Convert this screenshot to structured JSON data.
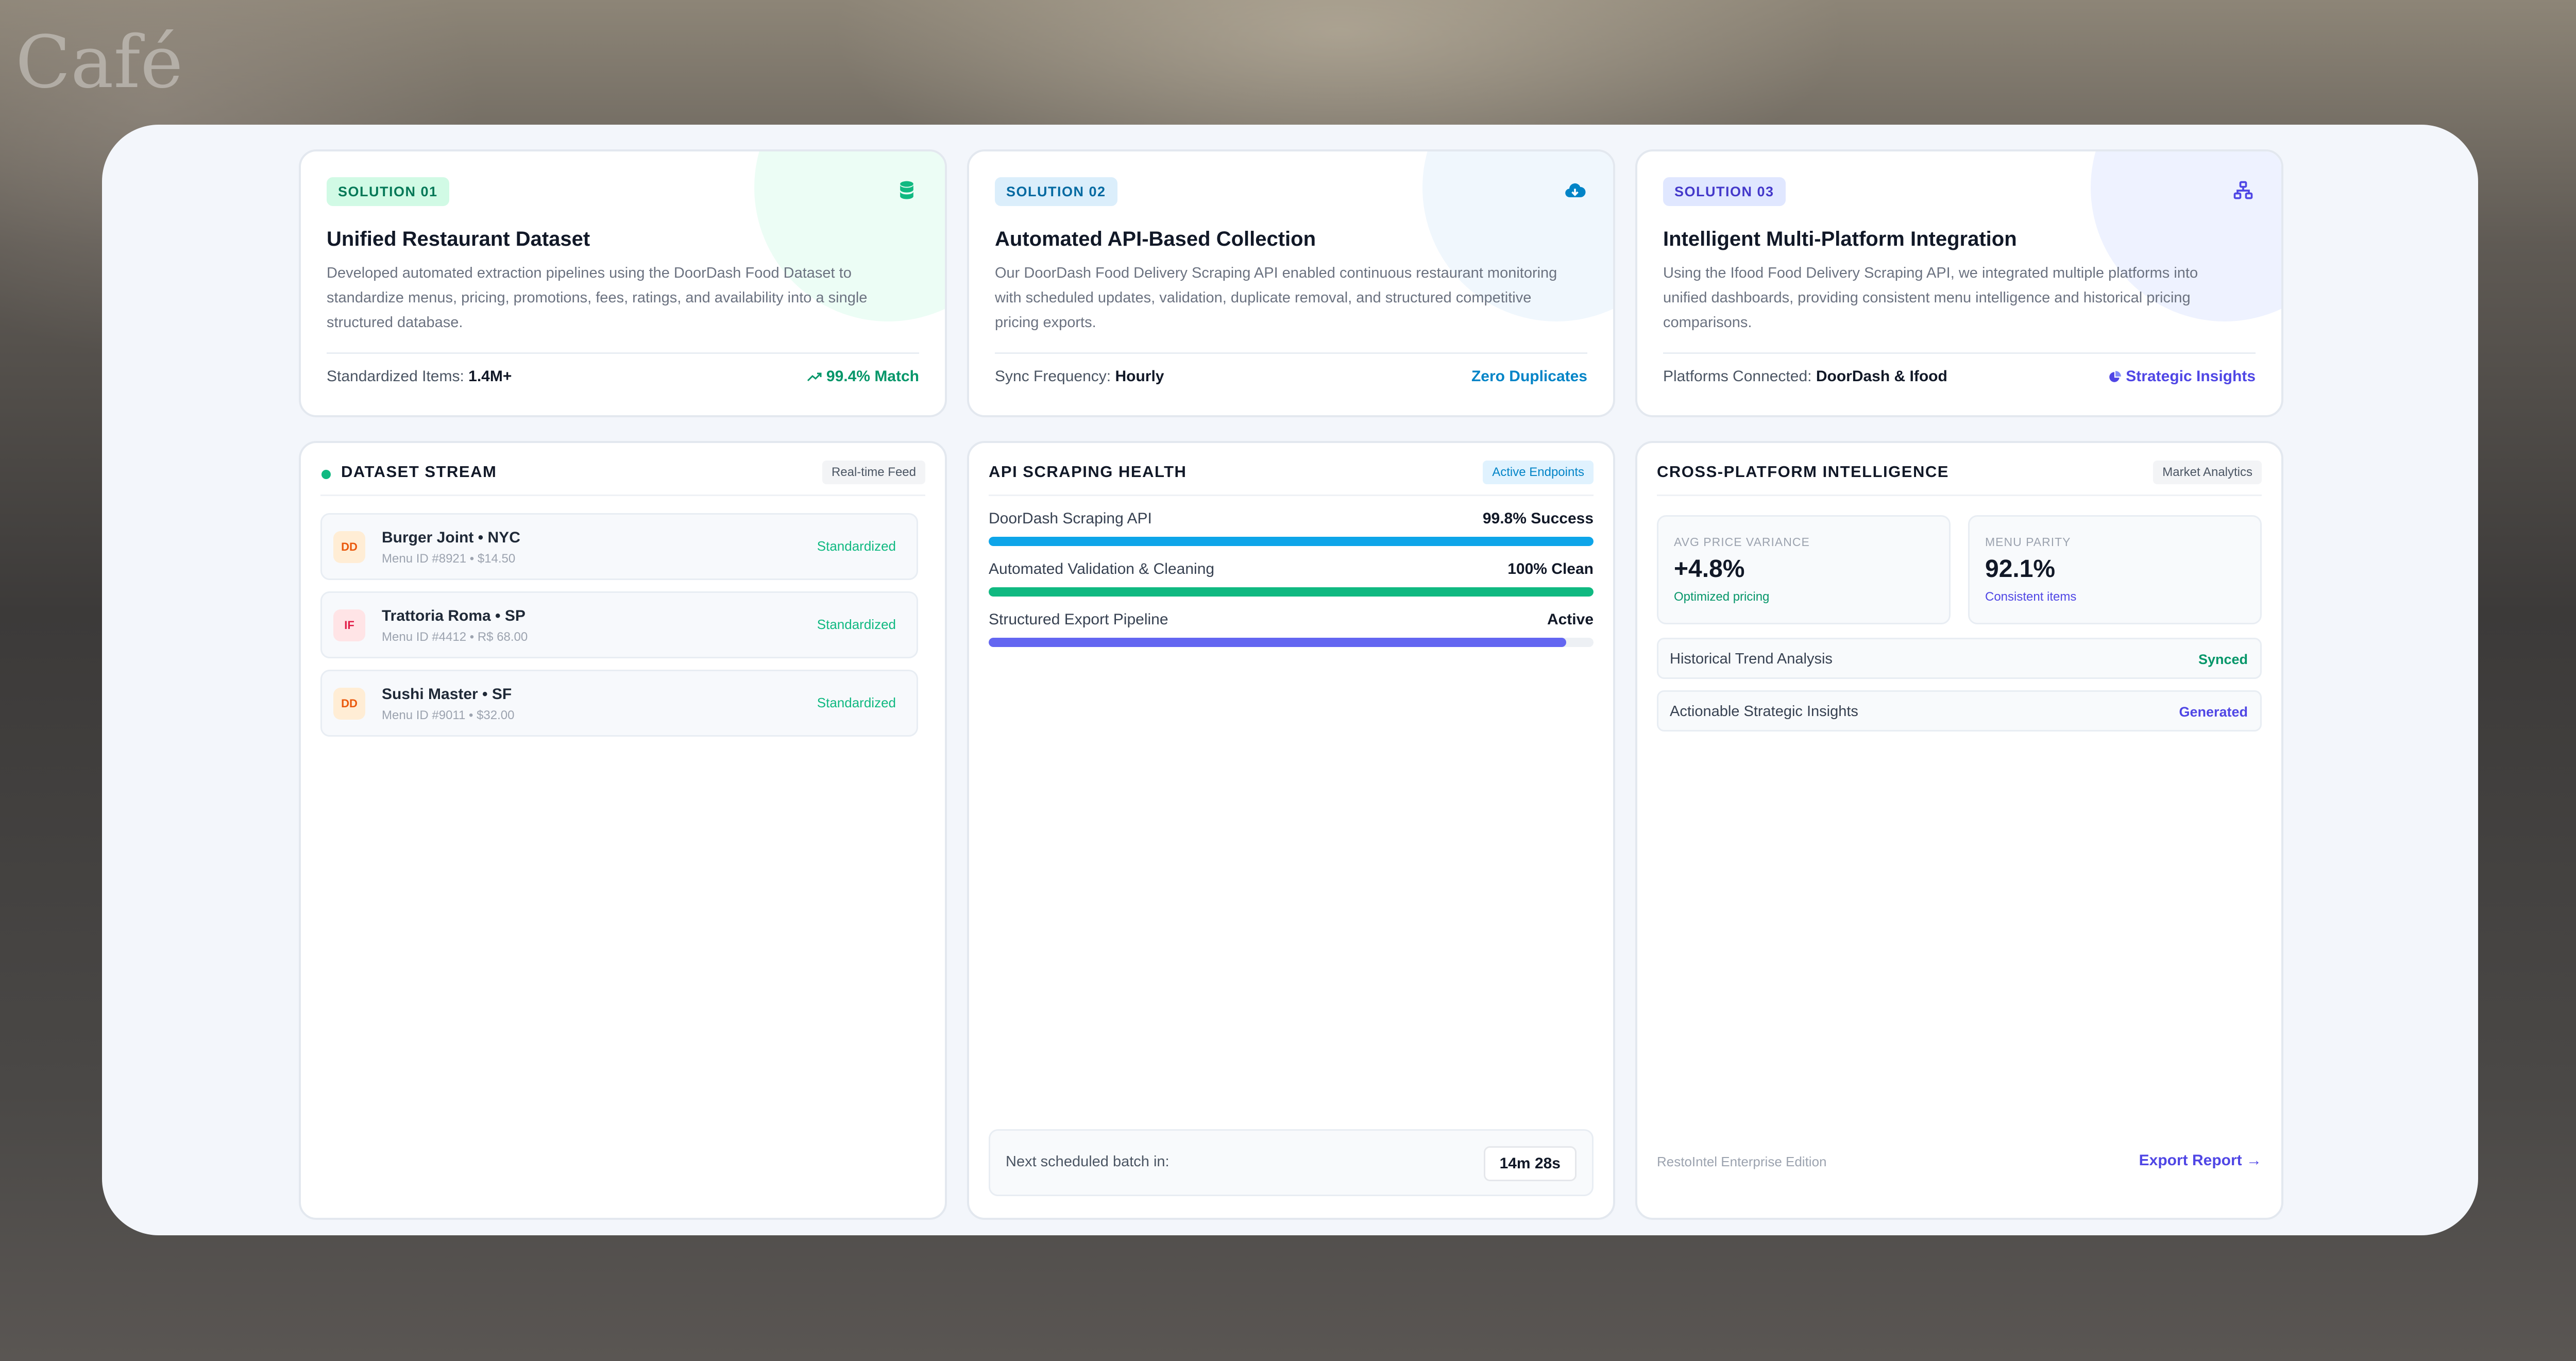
{
  "background": {
    "sign_text": "Café"
  },
  "solutions": [
    {
      "badge": "SOLUTION 01",
      "icon": "database-icon",
      "title": "Unified Restaurant Dataset",
      "description": "Developed automated extraction pipelines using the DoorDash Food Dataset to standardize menus, pricing, promotions, fees, ratings, and availability into a single structured database.",
      "footer_label": "Standardized Items:",
      "footer_value": "1.4M+",
      "footer_right": "99.4% Match",
      "footer_right_icon": "trend-up-icon"
    },
    {
      "badge": "SOLUTION 02",
      "icon": "cloud-download-icon",
      "title": "Automated API-Based Collection",
      "description": "Our DoorDash Food Delivery Scraping API enabled continuous restaurant monitoring with scheduled updates, validation, duplicate removal, and structured competitive pricing exports.",
      "footer_label": "Sync Frequency:",
      "footer_value": "Hourly",
      "footer_right": "Zero Duplicates"
    },
    {
      "badge": "SOLUTION 03",
      "icon": "sitemap-icon",
      "title": "Intelligent Multi-Platform Integration",
      "description": "Using the Ifood Food Delivery Scraping API, we integrated multiple platforms into unified dashboards, providing consistent menu intelligence and historical pricing comparisons.",
      "footer_label": "Platforms Connected:",
      "footer_value": "DoorDash & Ifood",
      "footer_right": "Strategic Insights",
      "footer_right_icon": "pie-chart-icon"
    }
  ],
  "stream": {
    "title": "DATASET STREAM",
    "tag": "Real-time Feed",
    "items": [
      {
        "avatar": "DD",
        "name": "Burger Joint • NYC",
        "meta": "Menu ID #8921 • $14.50",
        "status": "Standardized"
      },
      {
        "avatar": "IF",
        "name": "Trattoria Roma • SP",
        "meta": "Menu ID #4412 • R$ 68.00",
        "status": "Standardized"
      },
      {
        "avatar": "DD",
        "name": "Sushi Master • SF",
        "meta": "Menu ID #9011 • $32.00",
        "status": "Standardized"
      }
    ]
  },
  "health": {
    "title": "API SCRAPING HEALTH",
    "tag": "Active Endpoints",
    "bars": [
      {
        "label": "DoorDash Scraping API",
        "value": "99.8% Success",
        "fill": 1.0,
        "color": "#0ea5e9"
      },
      {
        "label": "Automated Validation & Cleaning",
        "value": "100% Clean",
        "fill": 1.0,
        "color": "#10b981"
      },
      {
        "label": "Structured Export Pipeline",
        "value": "Active",
        "fill": 0.955,
        "color": "#6366f1"
      }
    ],
    "next_batch_label": "Next scheduled batch in:",
    "next_batch_value": "14m 28s"
  },
  "intel": {
    "title": "CROSS-PLATFORM INTELLIGENCE",
    "tag": "Market Analytics",
    "metrics": [
      {
        "label": "AVG PRICE VARIANCE",
        "value": "+4.8%",
        "sub": "Optimized pricing"
      },
      {
        "label": "MENU PARITY",
        "value": "92.1%",
        "sub": "Consistent items"
      }
    ],
    "rows": [
      {
        "label": "Historical Trend Analysis",
        "status": "Synced"
      },
      {
        "label": "Actionable Strategic Insights",
        "status": "Generated"
      }
    ],
    "edition": "RestoIntel Enterprise Edition",
    "export": "Export Report"
  },
  "colors": {
    "green": "#10b981",
    "blue": "#0284c7",
    "indigo": "#4f46e5"
  }
}
